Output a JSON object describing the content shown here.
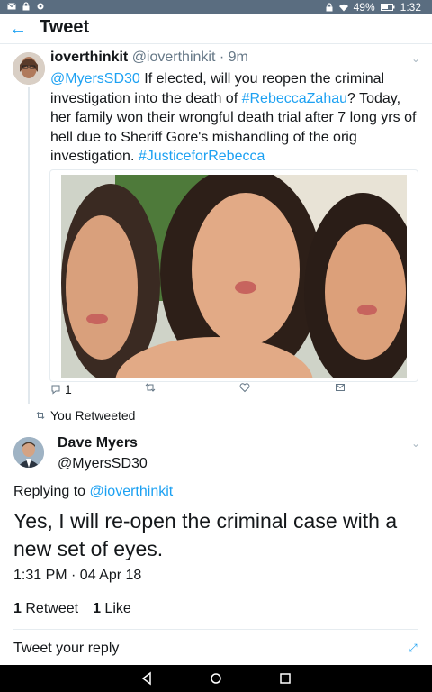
{
  "status_bar": {
    "battery": "49%",
    "time": "1:32",
    "left_icons": [
      "mail-icon",
      "lock-icon",
      "settings-icon"
    ],
    "right_icons": [
      "lock-icon",
      "wifi-icon",
      "battery-icon"
    ]
  },
  "header": {
    "back_icon": "back-arrow-icon",
    "title": "Tweet"
  },
  "quoted_tweet": {
    "name": "ioverthinkit",
    "handle": "@ioverthinkit",
    "time": "· 9m",
    "mention": "@MyersSD30",
    "text_1": " If elected, will you reopen the criminal investigation into the death of ",
    "hashtag_1": "#RebeccaZahau",
    "text_2": "? Today, her family won their wrongful death trial after 7 long yrs of hell due to Sheriff Gore's mishandling of the orig investigation. ",
    "hashtag_2": "#JusticeforRebecca",
    "reply_count": "1",
    "action_icons": [
      "reply-icon",
      "retweet-icon",
      "like-icon",
      "message-icon"
    ]
  },
  "retweet_notice": {
    "label": "You Retweeted"
  },
  "main_tweet": {
    "name": "Dave Myers",
    "handle": "@MyersSD30",
    "replying_prefix": "Replying to ",
    "replying_to": "@ioverthinkit",
    "text": "Yes, I will re-open the criminal case with a new set of eyes.",
    "timestamp": "1:31 PM · 04 Apr 18",
    "retweet_count": "1",
    "retweet_label": "Retweet",
    "like_count": "1",
    "like_label": "Like"
  },
  "reply": {
    "placeholder": "Tweet your reply"
  },
  "colors": {
    "accent": "#1da1f2",
    "status_bar": "#5a6d80",
    "nav_bar": "#000000"
  }
}
